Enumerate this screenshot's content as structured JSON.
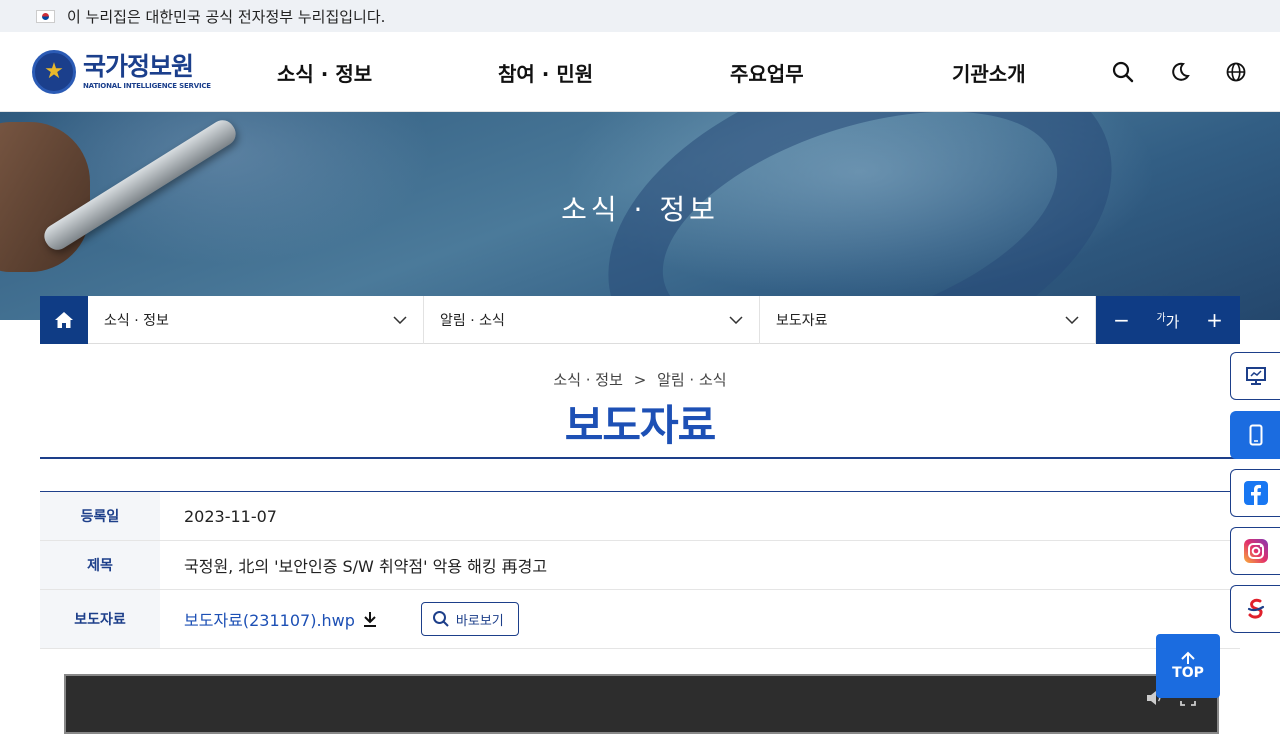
{
  "gov_banner": {
    "text": "이 누리집은 대한민국 공식 전자정부 누리집입니다."
  },
  "logo": {
    "korean": "국가정보원",
    "english": "NATIONAL INTELLIGENCE SERVICE"
  },
  "gnb": [
    "소식 · 정보",
    "참여 · 민원",
    "주요업무",
    "기관소개"
  ],
  "hero": {
    "title": "소식 · 정보"
  },
  "location": {
    "level1": "소식 · 정보",
    "level2": "알림 · 소식",
    "level3": "보도자료"
  },
  "font_control": {
    "minus": "−",
    "label_small": "가",
    "label_big": "가",
    "plus": "+"
  },
  "breadcrumb": {
    "item1": "소식 · 정보",
    "sep": ">",
    "item2": "알림 · 소식"
  },
  "page_title": "보도자료",
  "table": {
    "date_label": "등록일",
    "date_value": "2023-11-07",
    "title_label": "제목",
    "title_value": "국정원, 北의 '보안인증 S/W 취약점' 악용 해킹 再경고",
    "file_label": "보도자료",
    "file_name": "보도자료(231107).hwp",
    "view_label": "바로보기"
  },
  "top_button": "TOP",
  "colors": {
    "primary": "#0f3c85",
    "title_blue": "#1d50b5",
    "top_blue": "#1b6ce0"
  }
}
